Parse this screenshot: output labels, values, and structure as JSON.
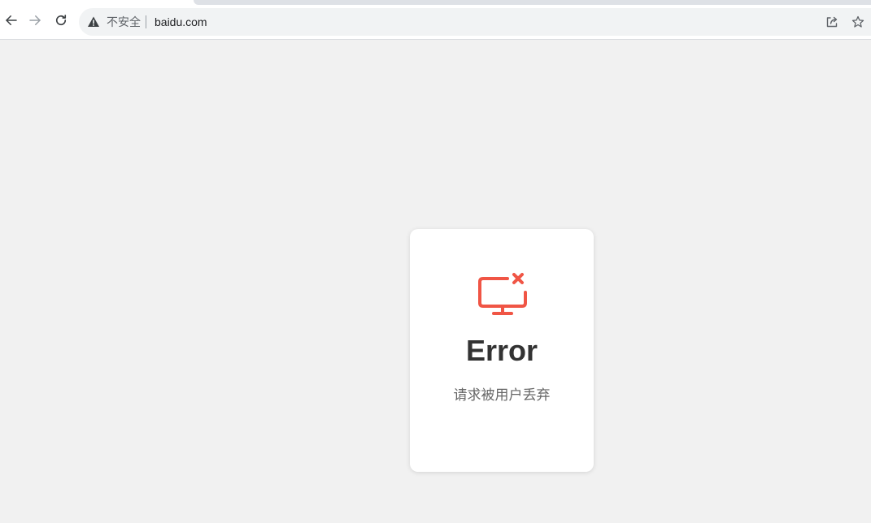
{
  "browser": {
    "nav": {
      "back_icon": "arrow-left-icon",
      "forward_icon": "arrow-right-icon",
      "reload_icon": "reload-icon"
    },
    "omnibox": {
      "security_icon": "warning-triangle-icon",
      "security_label": "不安全",
      "url": "baidu.com",
      "share_icon": "share-icon",
      "bookmark_icon": "star-icon"
    }
  },
  "error_card": {
    "icon": "monitor-error-icon",
    "title": "Error",
    "message": "请求被用户丢弃"
  },
  "colors": {
    "page_background": "#f1f1f1",
    "card_background": "#ffffff",
    "accent_error": "#f05545",
    "title_text": "#333333",
    "message_text": "#666666"
  }
}
